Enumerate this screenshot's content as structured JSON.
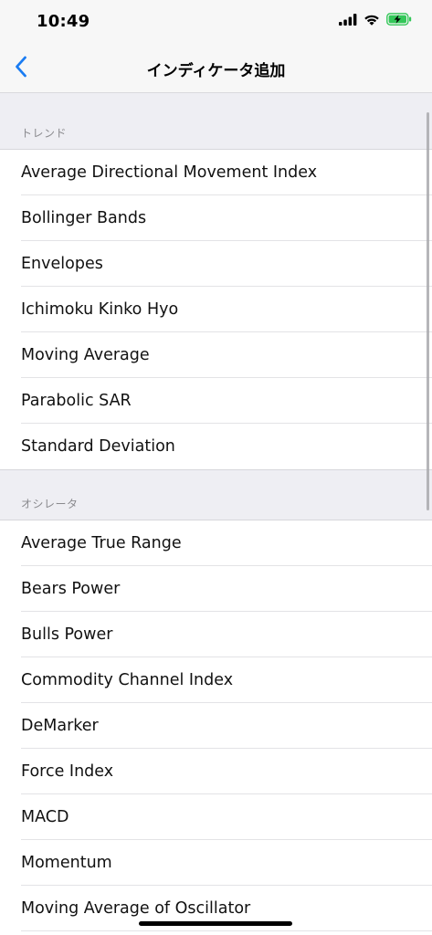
{
  "status_bar": {
    "time": "10:49"
  },
  "nav": {
    "title": "インディケータ追加",
    "back_icon": "chevron-left-icon",
    "accent_color": "#1a7cf2"
  },
  "sections": [
    {
      "header": "トレンド",
      "items": [
        "Average Directional Movement Index",
        "Bollinger Bands",
        "Envelopes",
        "Ichimoku Kinko Hyo",
        "Moving Average",
        "Parabolic SAR",
        "Standard Deviation"
      ]
    },
    {
      "header": "オシレータ",
      "items": [
        "Average True Range",
        "Bears Power",
        "Bulls Power",
        "Commodity Channel Index",
        "DeMarker",
        "Force Index",
        "MACD",
        "Momentum",
        "Moving Average of Oscillator"
      ]
    }
  ],
  "battery": {
    "charging": true,
    "color": "#34c759"
  }
}
